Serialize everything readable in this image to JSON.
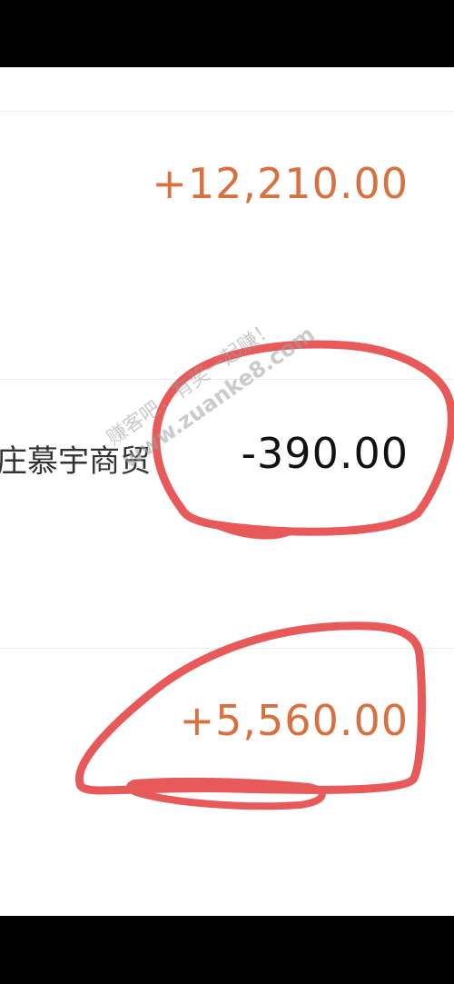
{
  "transactions": [
    {
      "merchant": "",
      "amount": "+12,210.00",
      "direction": "income",
      "color": "#d9703f"
    },
    {
      "merchant": "庄慕宇商贸",
      "amount": "-390.00",
      "direction": "expense",
      "color": "#111111"
    },
    {
      "merchant": "",
      "amount": "+5,560.00",
      "direction": "income",
      "color": "#d9703f"
    }
  ],
  "overlay": {
    "marker_color": "#e85a5a",
    "watermark_line1": "赚客吧，有奖一起赚！",
    "watermark_line2": "www.zuanke8.com"
  }
}
